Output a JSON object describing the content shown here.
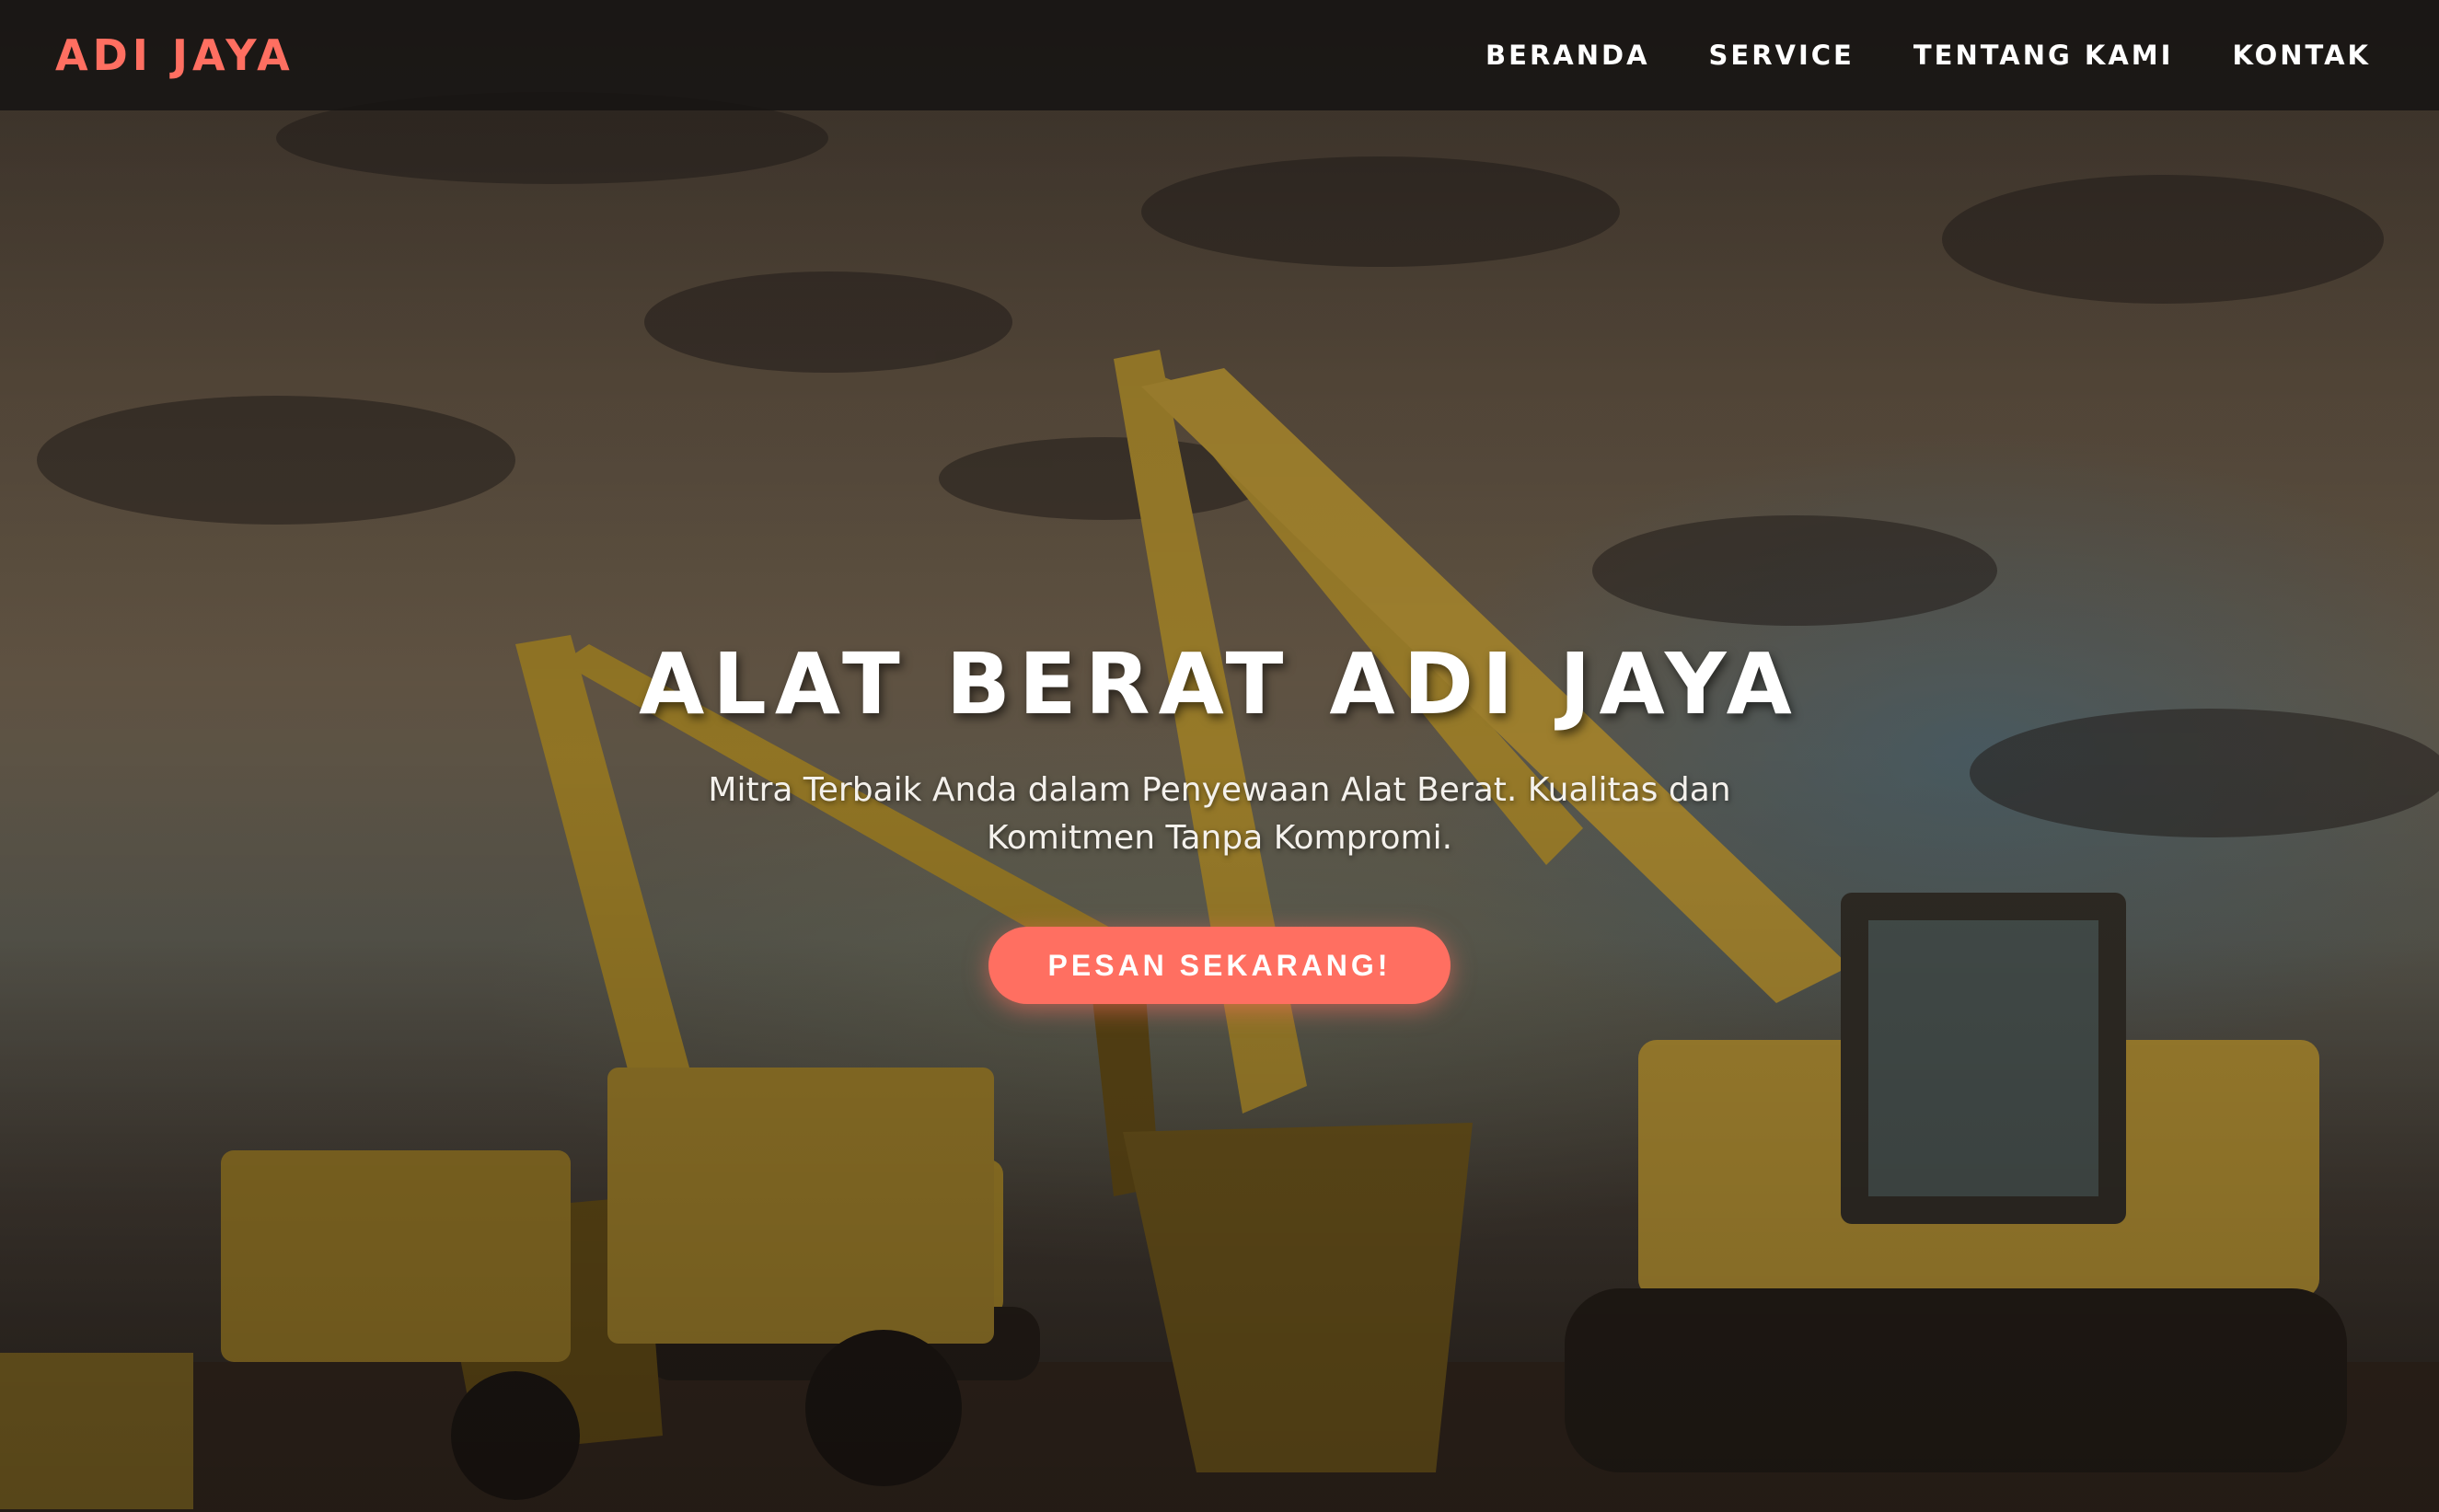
{
  "navbar": {
    "brand": "ADI JAYA",
    "links": [
      {
        "label": "BERANDA"
      },
      {
        "label": "SERVICE"
      },
      {
        "label": "TENTANG KAMI"
      },
      {
        "label": "KONTAK"
      }
    ]
  },
  "hero": {
    "title": "ALAT BERAT ADI JAYA",
    "subtitle": "Mitra Terbaik Anda dalam Penyewaan Alat Berat. Kualitas dan Komitmen Tanpa Kompromi.",
    "cta_label": "PESAN SEKARANG!",
    "background_image": "excavators-at-sunset-construction-site"
  },
  "colors": {
    "accent": "#ff6f61",
    "navbar_bg": "#161413",
    "text": "#ffffff"
  }
}
